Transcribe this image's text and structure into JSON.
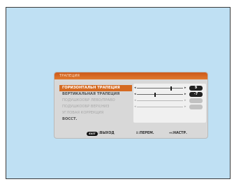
{
  "menu": {
    "title": "ТРАПЕЦИЯ",
    "rows": [
      {
        "label": "ГОРИЗОНТАЛЬН ТРАПЕЦИЯ",
        "state": "selected",
        "value": "9",
        "level": 0.77
      },
      {
        "label": "ВЕРТИКАЛЬНАЯ ТРАПЕЦИЯ",
        "state": "active",
        "value": "-7",
        "level": 0.38
      },
      {
        "label": "ПОДУШКООБР ЛЕВО/ПРАВО",
        "state": "dim",
        "value": "",
        "level": null
      },
      {
        "label": "ПОДУШКООБР ВЕРХ/НИЗ",
        "state": "dim",
        "value": "",
        "level": null
      },
      {
        "label": "УГЛОВАЯ КОРРЕКЦИЯ",
        "state": "dim-label",
        "value": "",
        "level": null
      },
      {
        "label": "ВОССТ.",
        "state": "active-label",
        "value": "",
        "level": null
      }
    ],
    "footer": {
      "exit_key": "EXIT",
      "exit_label": ":ВЫХОД",
      "move_label": "↕:ПЕРЕМ.",
      "adjust_label": "↔:НАСТР."
    }
  },
  "colors": {
    "screen_bg": "#bfe0f3",
    "accent": "#d56a21"
  }
}
